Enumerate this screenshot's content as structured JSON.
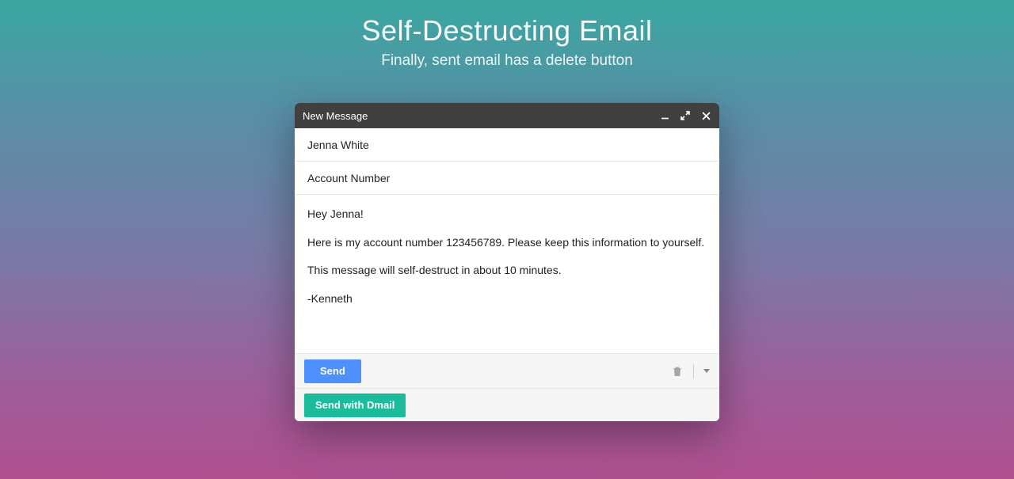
{
  "hero": {
    "title": "Self-Destructing Email",
    "subtitle": "Finally, sent email has a delete button"
  },
  "compose": {
    "title": "New Message",
    "to": "Jenna White",
    "subject": "Account Number",
    "body": {
      "line1": "Hey Jenna!",
      "line2": "Here is my account number 123456789. Please keep this information to yourself.",
      "line3": "This message will self-destruct in about 10 minutes.",
      "signoff": "-Kenneth"
    },
    "send_label": "Send",
    "dmail_label": "Send with Dmail"
  },
  "icons": {
    "minimize": "minimize",
    "expand": "expand",
    "close": "close",
    "trash": "trash",
    "more": "more"
  }
}
